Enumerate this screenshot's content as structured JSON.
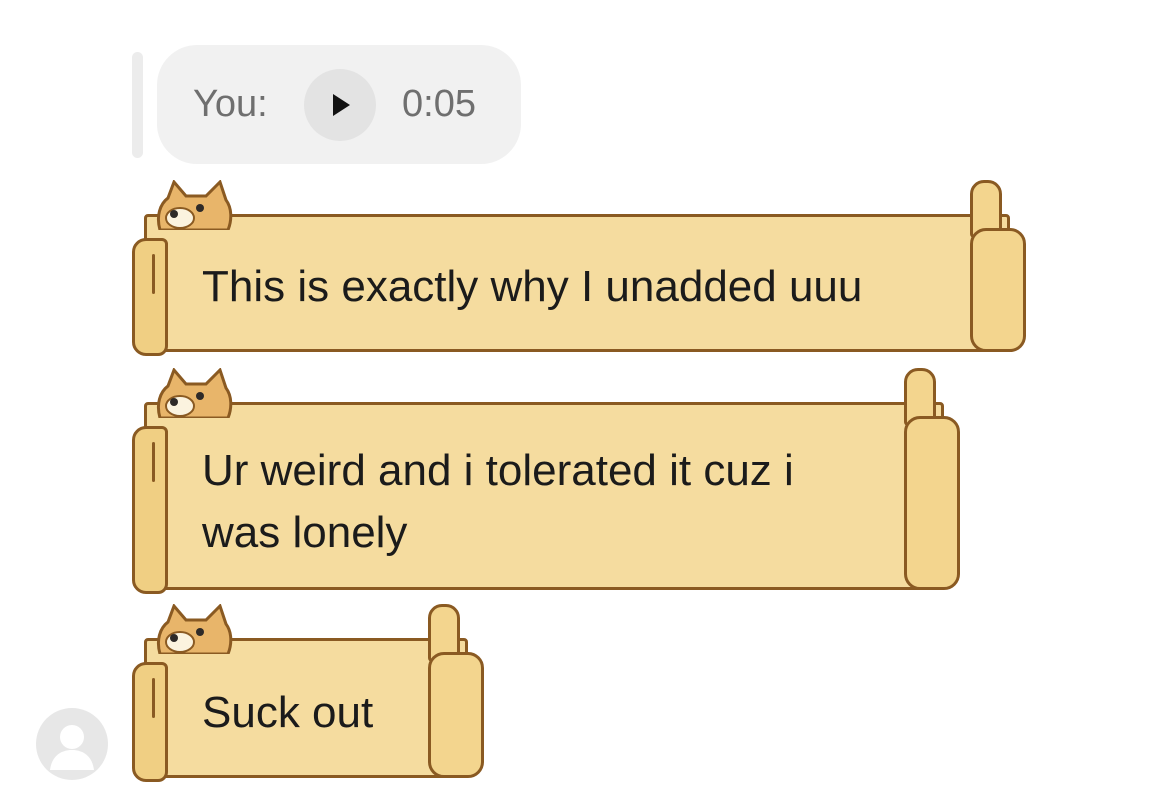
{
  "voice_message": {
    "sender_label": "You:",
    "duration": "0:05",
    "play_icon": "play-icon"
  },
  "messages": [
    {
      "text_lines": [
        "This is exactly why I unadded uuu"
      ]
    },
    {
      "text_lines": [
        "Ur weird and i tolerated it cuz i",
        "was lonely"
      ]
    },
    {
      "text_lines": [
        "Suck out"
      ]
    }
  ],
  "avatar": {
    "icon": "user-avatar-icon"
  },
  "colors": {
    "bubble_fill": "#f5dc9f",
    "bubble_outline": "#8a5a22",
    "voice_bubble": "#f1f1f1",
    "text": "#1b1b1b",
    "muted_text": "#6f6f6f"
  }
}
